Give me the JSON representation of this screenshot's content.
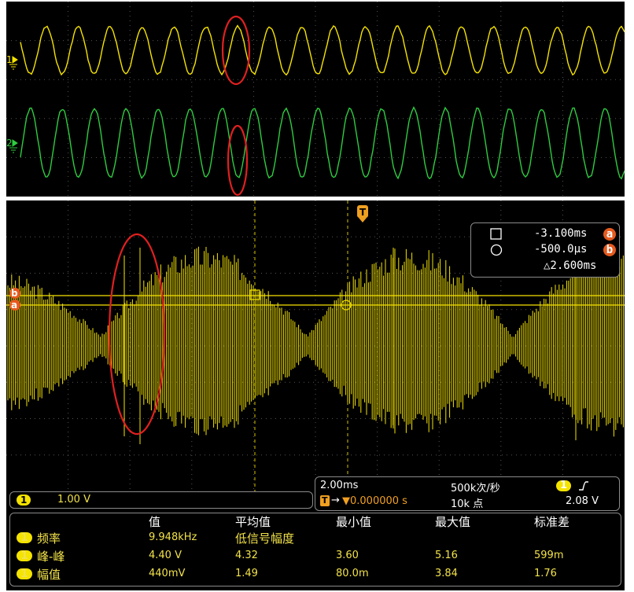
{
  "colors": {
    "ch1": "#f5e300",
    "ch2": "#2ecc40",
    "highlight": "#e02020",
    "cursor_label": "#e55a1f"
  },
  "top_panel": {
    "ch1_marker": "1",
    "ch2_marker": "2"
  },
  "main_panel": {
    "trigger_marker": "T",
    "cursor_a_marker": "a",
    "cursor_b_marker": "b",
    "cursors": {
      "a_icon": "square-cursor-icon",
      "a_value": "-3.100ms",
      "a_label": "a",
      "b_icon": "circle-cursor-icon",
      "b_value": "-500.0µs",
      "b_label": "b",
      "delta": "△2.600ms"
    },
    "timebase": {
      "scale": "2.00ms",
      "sample_rate": "500k次/秒",
      "trigger_channel": "1",
      "trigger_slope_icon": "rising-edge-icon",
      "trigger_pos_icon": "trigger-position-icon",
      "trigger_offset": "▼0.000000 s",
      "record_length": "10k 点",
      "trigger_level": "2.08 V"
    },
    "vertical": {
      "channel": "1",
      "scale": "1.00 V"
    }
  },
  "measurements": {
    "headers": [
      "值",
      "平均值",
      "最小值",
      "最大值",
      "标准差"
    ],
    "rows": [
      {
        "channel": "1",
        "name": "频率",
        "value": "9.948kHz",
        "mean": "低信号幅度",
        "min": "",
        "max": "",
        "std": ""
      },
      {
        "channel": "1",
        "name": "峰-峰",
        "value": "4.40 V",
        "mean": "4.32",
        "min": "3.60",
        "max": "5.16",
        "std": "599m"
      },
      {
        "channel": "1",
        "name": "幅值",
        "value": "440mV",
        "mean": "1.49",
        "min": "80.0m",
        "max": "3.84",
        "std": "1.76"
      }
    ]
  }
}
